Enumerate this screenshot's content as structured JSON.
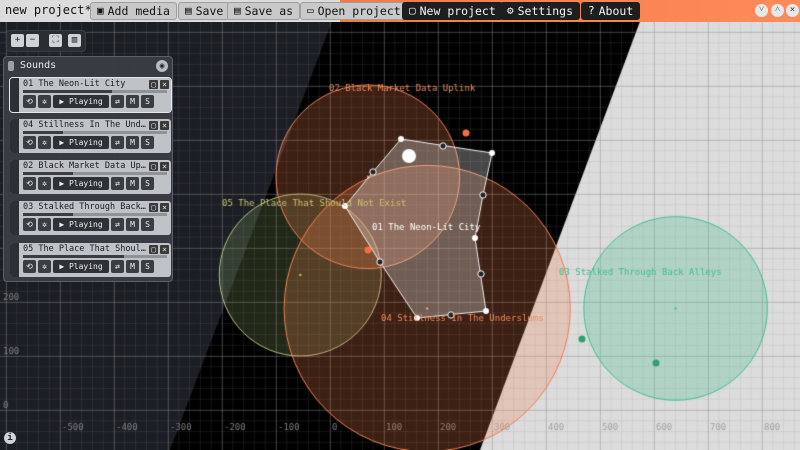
{
  "toolbar": {
    "project_title": "new project*",
    "add_media": "Add media",
    "save": "Save",
    "save_as": "Save as",
    "open_project": "Open project",
    "new_project": "New project",
    "settings": "Settings",
    "about": "About"
  },
  "sounds_panel": {
    "title": "Sounds",
    "tracks": [
      {
        "name": "01 The Neon-Lit City",
        "status": "Playing",
        "progress": 0.62,
        "selected": true
      },
      {
        "name": "04 Stillness In The Und…",
        "status": "Playing",
        "progress": 0.28,
        "selected": false
      },
      {
        "name": "02 Black Market Data Up…",
        "status": "Playing",
        "progress": 0.35,
        "selected": false
      },
      {
        "name": "03 Stalked Through Back…",
        "status": "Playing",
        "progress": 0.35,
        "selected": false
      },
      {
        "name": "05 The Place That Shoul…",
        "status": "Playing",
        "progress": 0.7,
        "selected": false
      }
    ],
    "mute_label": "M",
    "solo_label": "S"
  },
  "map": {
    "x_ticks": [
      "-500",
      "-400",
      "-300",
      "-200",
      "-100",
      "0",
      "100",
      "200",
      "300",
      "400",
      "500",
      "600",
      "700",
      "800"
    ],
    "y_ticks": [
      "0",
      "100",
      "200"
    ],
    "sources": [
      {
        "label": "01 The Neon-Lit City",
        "color": "#ffffff",
        "cx": 150,
        "cy": 112
      },
      {
        "label": "02 Black Market Data Uplink",
        "color": "#f08050",
        "cx": 70,
        "cy": 432,
        "r": 170
      },
      {
        "label": "03 Stalked Through Back Alleys",
        "color": "#40c090",
        "cx": 640,
        "cy": 188,
        "r": 170
      },
      {
        "label": "04 Stillness In The Underslums",
        "color": "#f08050",
        "cx": 180,
        "cy": 188,
        "r": 265
      },
      {
        "label": "05 The Place That Should Not Exist",
        "color": "#d08050",
        "cx": -55,
        "cy": 250,
        "r": 150
      }
    ],
    "listener_zone": "polygon"
  }
}
